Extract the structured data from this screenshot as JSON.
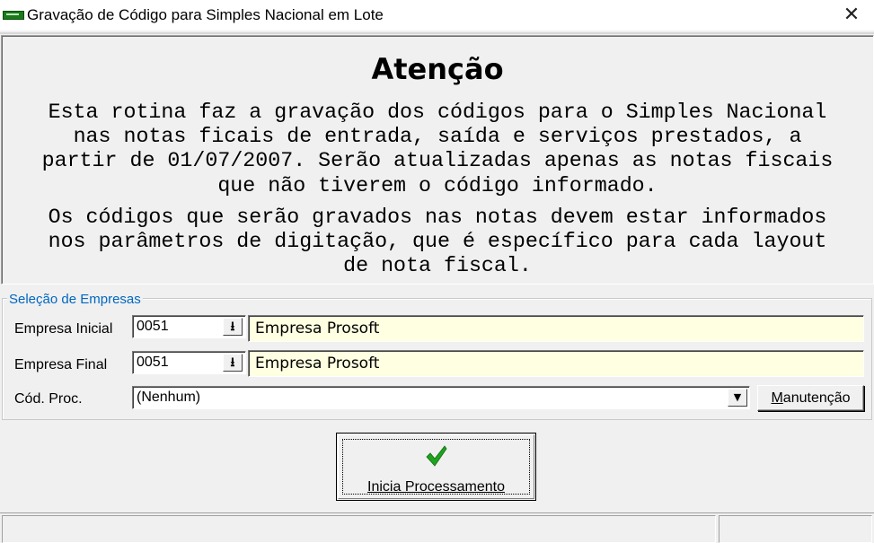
{
  "window": {
    "title": "Gravação de Código para Simples Nacional em Lote",
    "close_glyph": "✕",
    "app_icon": "app-icon"
  },
  "attention": {
    "heading": "Atenção",
    "paragraph1": "Esta rotina faz a gravação dos códigos para o Simples Nacional\nnas notas ficais de entrada, saída e serviços prestados, a\npartir de 01/07/2007. Serão atualizadas apenas as notas fiscais\nque não tiverem o código informado.",
    "paragraph2": "Os códigos que serão gravados nas notas devem estar informados\nnos parâmetros de digitação, que é específico para cada layout\nde nota fiscal."
  },
  "selection": {
    "group_title": "Seleção de Empresas",
    "empresa_inicial": {
      "label": "Empresa Inicial",
      "code": "0051",
      "name": "Empresa Prosoft"
    },
    "empresa_final": {
      "label": "Empresa Final",
      "code": "0051",
      "name": "Empresa Prosoft"
    },
    "cod_proc": {
      "label": "Cód. Proc.",
      "value": "(Nenhum)"
    },
    "manutencao": {
      "label_first": "M",
      "label_rest": "anutenção"
    }
  },
  "actions": {
    "start_label": "Inicia Processamento",
    "start_icon": "checkmark-icon"
  },
  "colors": {
    "window_bg": "#f0f0f0",
    "legend_blue": "#0067c0",
    "readonly_field_bg": "#ffffe1",
    "check_green": "#1fa31f"
  }
}
